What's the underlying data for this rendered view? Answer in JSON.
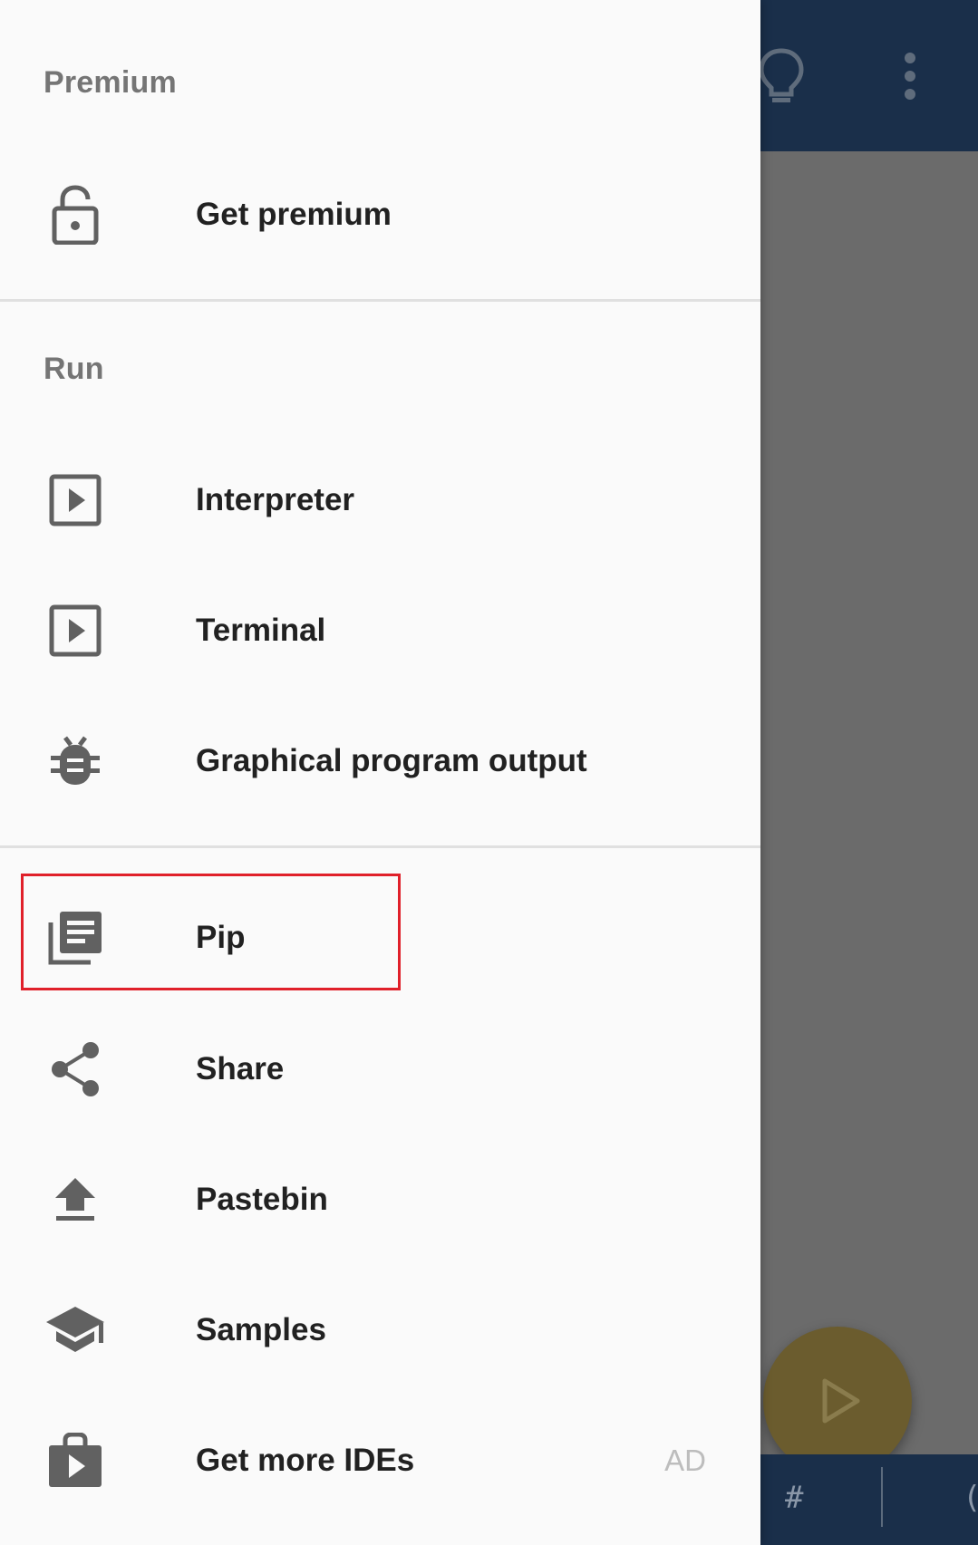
{
  "drawer": {
    "sections": [
      {
        "header": "Premium"
      },
      {
        "header": "Run"
      }
    ],
    "items": [
      {
        "label": "Get premium",
        "icon": "lock-open-icon"
      },
      {
        "label": "Interpreter",
        "icon": "play-box-icon"
      },
      {
        "label": "Terminal",
        "icon": "play-box-icon"
      },
      {
        "label": "Graphical program output",
        "icon": "bug-icon"
      },
      {
        "label": "Pip",
        "icon": "library-books-icon"
      },
      {
        "label": "Share",
        "icon": "share-icon"
      },
      {
        "label": "Pastebin",
        "icon": "upload-icon"
      },
      {
        "label": "Samples",
        "icon": "school-icon"
      },
      {
        "label": "Get more IDEs",
        "icon": "shop-icon",
        "badge": "AD"
      }
    ]
  },
  "background_app": {
    "toolbar_icons": [
      "lightbulb-icon",
      "more-vert-icon"
    ],
    "bottom_keys": [
      "#",
      "("
    ]
  },
  "colors": {
    "toolbar": "#1a2f4a",
    "scrim": "#6b6b6b",
    "fab": "#6b5c2e",
    "highlight_border": "#e0202a",
    "icon_gray": "#616161"
  }
}
